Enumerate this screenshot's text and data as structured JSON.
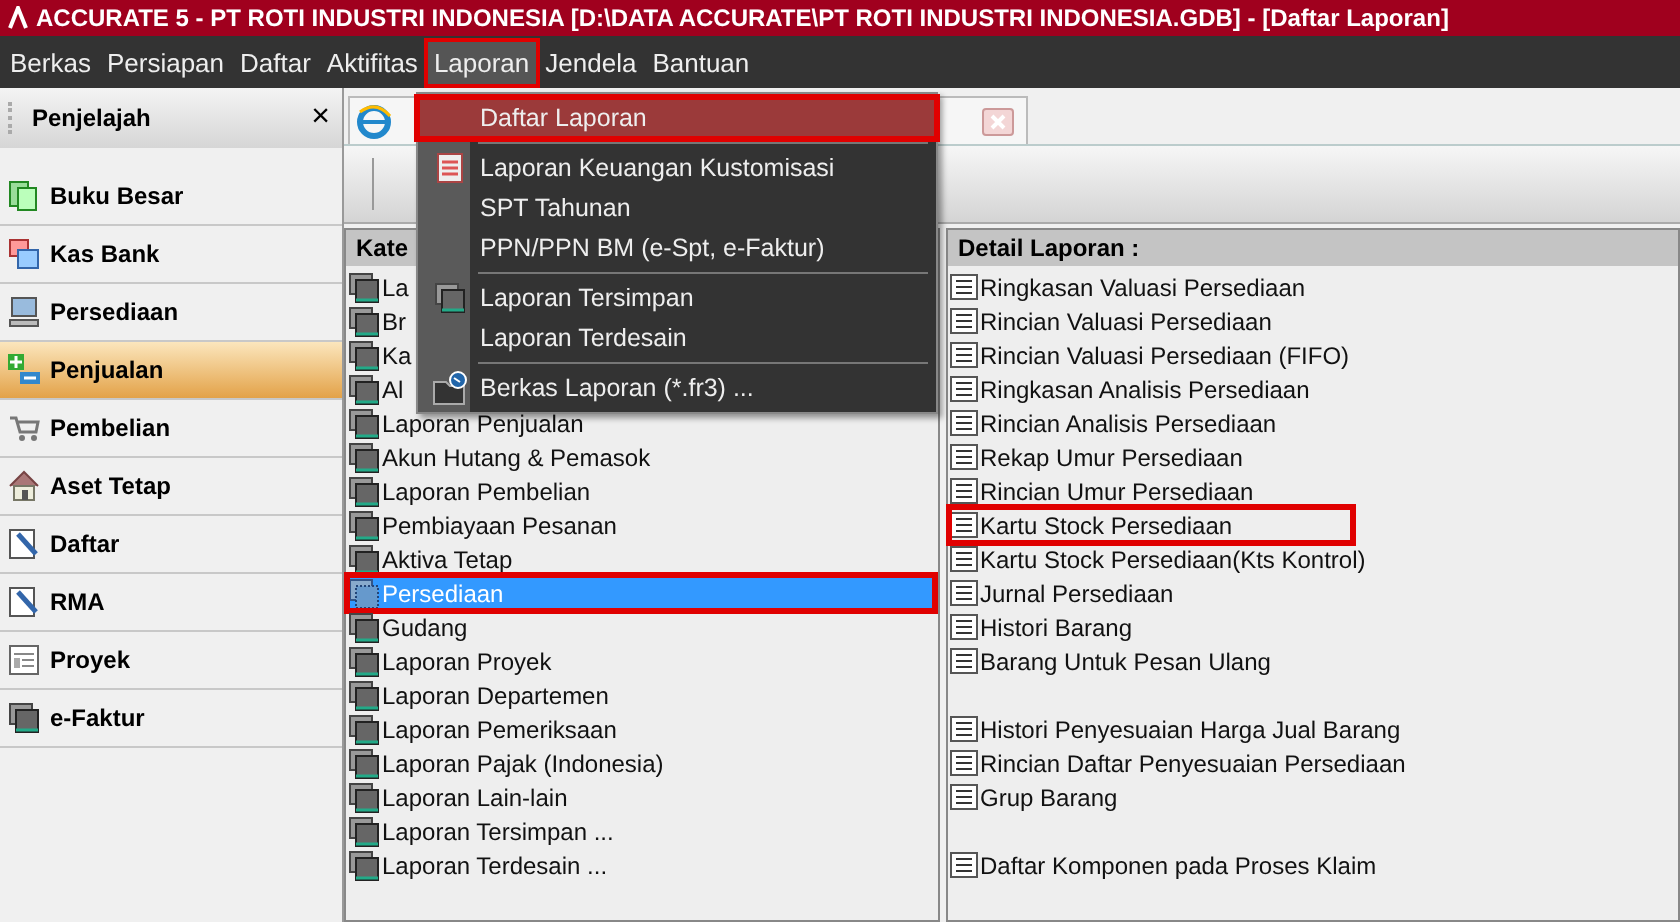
{
  "window": {
    "title": "ACCURATE 5  - PT ROTI INDUSTRI INDONESIA   [D:\\DATA ACCURATE\\PT ROTI INDUSTRI INDONESIA.GDB] - [Daftar Laporan]"
  },
  "menu_bar": [
    {
      "label": "Berkas",
      "selected": false,
      "marked": false
    },
    {
      "label": "Persiapan",
      "selected": false,
      "marked": false
    },
    {
      "label": "Daftar",
      "selected": false,
      "marked": false
    },
    {
      "label": "Aktifitas",
      "selected": false,
      "marked": false
    },
    {
      "label": "Laporan",
      "selected": true,
      "marked": true
    },
    {
      "label": "Jendela",
      "selected": false,
      "marked": false
    },
    {
      "label": "Bantuan",
      "selected": false,
      "marked": false
    }
  ],
  "explorer": {
    "title": "Penjelajah",
    "close": "×",
    "items": [
      {
        "label": "Buku Besar",
        "kind": "ledger",
        "selected": false
      },
      {
        "label": "Kas Bank",
        "kind": "bank",
        "selected": false
      },
      {
        "label": "Persediaan",
        "kind": "computer",
        "selected": false
      },
      {
        "label": "Penjualan",
        "kind": "plusminus",
        "selected": true
      },
      {
        "label": "Pembelian",
        "kind": "cart",
        "selected": false
      },
      {
        "label": "Aset Tetap",
        "kind": "house",
        "selected": false
      },
      {
        "label": "Daftar",
        "kind": "pencil",
        "selected": false
      },
      {
        "label": "RMA",
        "kind": "pencil",
        "selected": false
      },
      {
        "label": "Proyek",
        "kind": "form",
        "selected": false
      },
      {
        "label": "e-Faktur",
        "kind": "stack",
        "selected": false
      }
    ]
  },
  "category_pane": {
    "header": "Kate",
    "items": [
      {
        "label": "La",
        "selected": false,
        "marked": false
      },
      {
        "label": "Br",
        "selected": false,
        "marked": false
      },
      {
        "label": "Ka",
        "selected": false,
        "marked": false
      },
      {
        "label": "Al",
        "selected": false,
        "marked": false
      },
      {
        "label": "Laporan Penjualan",
        "selected": false,
        "marked": false
      },
      {
        "label": "Akun Hutang & Pemasok",
        "selected": false,
        "marked": false
      },
      {
        "label": "Laporan Pembelian",
        "selected": false,
        "marked": false
      },
      {
        "label": "Pembiayaan Pesanan",
        "selected": false,
        "marked": false
      },
      {
        "label": "Aktiva Tetap",
        "selected": false,
        "marked": false
      },
      {
        "label": "Persediaan",
        "selected": true,
        "marked": true
      },
      {
        "label": "Gudang",
        "selected": false,
        "marked": false
      },
      {
        "label": "Laporan Proyek",
        "selected": false,
        "marked": false
      },
      {
        "label": "Laporan Departemen",
        "selected": false,
        "marked": false
      },
      {
        "label": "Laporan Pemeriksaan",
        "selected": false,
        "marked": false
      },
      {
        "label": "Laporan Pajak (Indonesia)",
        "selected": false,
        "marked": false
      },
      {
        "label": "Laporan Lain-lain",
        "selected": false,
        "marked": false
      },
      {
        "label": "Laporan Tersimpan ...",
        "selected": false,
        "marked": false
      },
      {
        "label": "Laporan Terdesain ...",
        "selected": false,
        "marked": false
      }
    ]
  },
  "detail_pane": {
    "header": "Detail Laporan :",
    "items": [
      {
        "label": "Ringkasan Valuasi Persediaan",
        "gap_before": false,
        "marked": false
      },
      {
        "label": "Rincian Valuasi Persediaan",
        "gap_before": false,
        "marked": false
      },
      {
        "label": "Rincian Valuasi Persediaan (FIFO)",
        "gap_before": false,
        "marked": false
      },
      {
        "label": "Ringkasan Analisis Persediaan",
        "gap_before": false,
        "marked": false
      },
      {
        "label": "Rincian Analisis Persediaan",
        "gap_before": false,
        "marked": false
      },
      {
        "label": "Rekap Umur Persediaan",
        "gap_before": false,
        "marked": false
      },
      {
        "label": "Rincian Umur Persediaan",
        "gap_before": false,
        "marked": false
      },
      {
        "label": "Kartu Stock Persediaan",
        "gap_before": false,
        "marked": true
      },
      {
        "label": "Kartu Stock Persediaan(Kts Kontrol)",
        "gap_before": false,
        "marked": false
      },
      {
        "label": "Jurnal Persediaan",
        "gap_before": false,
        "marked": false
      },
      {
        "label": "Histori Barang",
        "gap_before": false,
        "marked": false
      },
      {
        "label": "Barang Untuk Pesan Ulang",
        "gap_before": false,
        "marked": false
      },
      {
        "label": "Histori Penyesuaian Harga Jual Barang",
        "gap_before": true,
        "marked": false
      },
      {
        "label": "Rincian Daftar Penyesuaian Persediaan",
        "gap_before": false,
        "marked": false
      },
      {
        "label": "Grup Barang",
        "gap_before": false,
        "marked": false
      },
      {
        "label": "Daftar Komponen pada Proses Klaim",
        "gap_before": true,
        "marked": false
      }
    ]
  },
  "dropdown_menu": [
    {
      "kind": "plain",
      "label": "Daftar Laporan",
      "selected": true,
      "marked": true
    },
    {
      "kind": "separator"
    },
    {
      "kind": "document",
      "label": "Laporan Keuangan Kustomisasi",
      "selected": false,
      "marked": false
    },
    {
      "kind": "plain",
      "label": "SPT Tahunan",
      "selected": false,
      "marked": false
    },
    {
      "kind": "plain",
      "label": "PPN/PPN BM (e-Spt, e-Faktur)",
      "selected": false,
      "marked": false
    },
    {
      "kind": "separator"
    },
    {
      "kind": "stack",
      "label": "Laporan Tersimpan",
      "selected": false,
      "marked": false
    },
    {
      "kind": "plain",
      "label": "Laporan Terdesain",
      "selected": false,
      "marked": false
    },
    {
      "kind": "separator"
    },
    {
      "kind": "folder",
      "label": "Berkas Laporan (*.fr3) ...",
      "selected": false,
      "marked": false
    }
  ]
}
